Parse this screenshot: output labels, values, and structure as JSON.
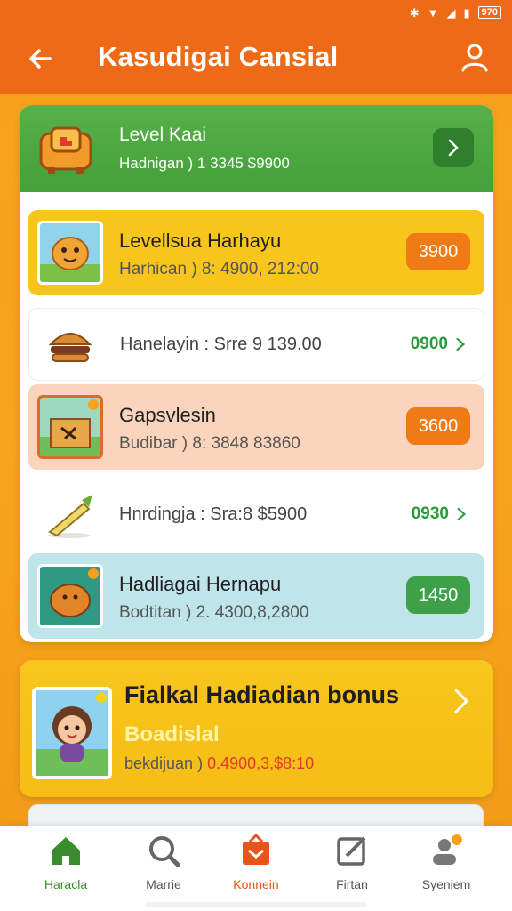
{
  "status_bar": {
    "battery": "970"
  },
  "header": {
    "title": "Kasudigai Cansial"
  },
  "hero": {
    "title": "Level Kaai",
    "subtitle": "Hadnigan ) 1 3345 $9900"
  },
  "items": [
    {
      "title": "Levellsua Harhayu",
      "subtitle": "Harhican ) 8: 4900, 212:00",
      "badge": "3900",
      "badge_color": "#f07b16"
    },
    {
      "label": "Hanelayin : Srre 9 139.00",
      "price": "0900"
    },
    {
      "title": "Gapsvlesin",
      "subtitle": "Budibar ) 8: 3848 83860",
      "badge": "3600",
      "badge_color": "#f07b16"
    },
    {
      "label": "Hnrdingja : Sra:8 $5900",
      "price": "0930"
    },
    {
      "title": "Hadliagai Hernapu",
      "subtitle": "Bodtitan ) 2. 4300,8,2800",
      "badge": "1450",
      "badge_color": "#3fa04a"
    }
  ],
  "bonus": {
    "title": "Fialkal Hadiadian bonus",
    "subtitle": "Boadislal",
    "detail_prefix": "bekdijuan ) ",
    "detail_value": "0.4900,3,$8:10"
  },
  "bottom_nav": [
    {
      "label": "Haracla",
      "icon": "home-icon"
    },
    {
      "label": "Marrie",
      "icon": "search-icon"
    },
    {
      "label": "Konnein",
      "icon": "bag-icon"
    },
    {
      "label": "Firtan",
      "icon": "edit-icon"
    },
    {
      "label": "Syeniem",
      "icon": "profile-icon"
    }
  ],
  "colors": {
    "header": "#ee6a17",
    "accent_green": "#43a03a",
    "accent_orange": "#f07b16",
    "background": "#f7a21b"
  }
}
